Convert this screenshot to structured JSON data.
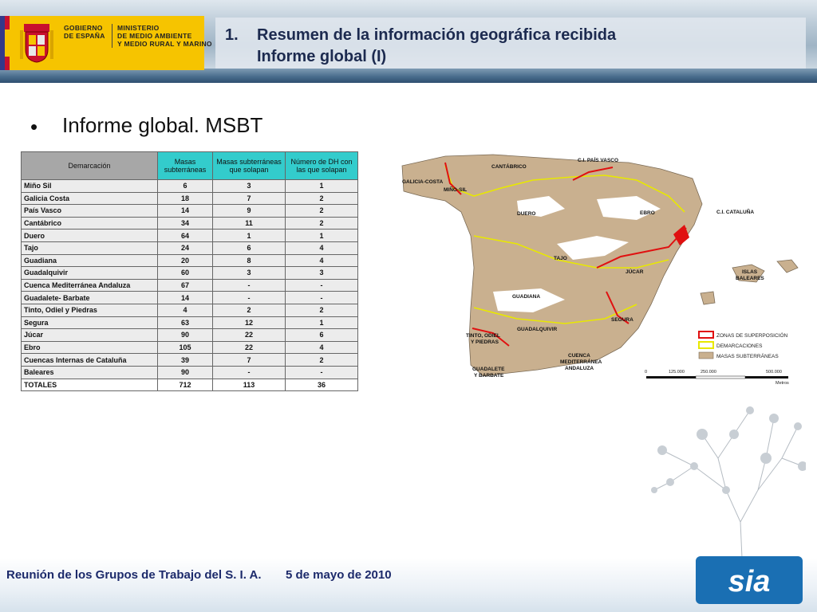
{
  "header": {
    "gobierno": [
      "GOBIERNO",
      "DE ESPAÑA"
    ],
    "ministerio": [
      "MINISTERIO",
      "DE MEDIO AMBIENTE",
      "Y MEDIO RURAL Y MARINO"
    ],
    "title_number": "1.",
    "title_line1": "Resumen de la información geográfica recibida",
    "title_line2": "Informe global (I)"
  },
  "main": {
    "bullet": "•",
    "heading": "Informe global. MSBT"
  },
  "table": {
    "headers": [
      "Demarcación",
      "Masas subterráneas",
      "Masas subterráneas que solapan",
      "Número de DH con las que solapan"
    ],
    "rows": [
      [
        "Miño Sil",
        "6",
        "3",
        "1"
      ],
      [
        "Galicia Costa",
        "18",
        "7",
        "2"
      ],
      [
        "País Vasco",
        "14",
        "9",
        "2"
      ],
      [
        "Cantábrico",
        "34",
        "11",
        "2"
      ],
      [
        "Duero",
        "64",
        "1",
        "1"
      ],
      [
        "Tajo",
        "24",
        "6",
        "4"
      ],
      [
        "Guadiana",
        "20",
        "8",
        "4"
      ],
      [
        "Guadalquivir",
        "60",
        "3",
        "3"
      ],
      [
        "Cuenca Mediterránea Andaluza",
        "67",
        "-",
        "-"
      ],
      [
        "Guadalete- Barbate",
        "14",
        "-",
        "-"
      ],
      [
        "Tinto, Odiel y Piedras",
        "4",
        "2",
        "2"
      ],
      [
        "Segura",
        "63",
        "12",
        "1"
      ],
      [
        "Júcar",
        "90",
        "22",
        "6"
      ],
      [
        "Ebro",
        "105",
        "22",
        "4"
      ],
      [
        "Cuencas Internas de Cataluña",
        "39",
        "7",
        "2"
      ],
      [
        "Baleares",
        "90",
        "-",
        "-"
      ]
    ],
    "totals": [
      "TOTALES",
      "712",
      "113",
      "36"
    ]
  },
  "map": {
    "labels": {
      "pais_vasco": "C.I. PAÍS VASCO",
      "cantabrico": "CANTÁBRICO",
      "galicia": "GALICIA-COSTA",
      "mino": "MIÑO-SIL",
      "duero": "DUERO",
      "ebro": "EBRO",
      "cataluna": "C.I. CATALUÑA",
      "tajo": "TAJO",
      "jucar": "JÚCAR",
      "baleares1": "ISLAS",
      "baleares2": "BALEARES",
      "guadiana": "GUADIANA",
      "segura": "SEGURA",
      "guadalquivir": "GUADALQUIVIR",
      "tinto1": "TINTO, ODIEL",
      "tinto2": "Y PIEDRAS",
      "cuenca1": "CUENCA",
      "cuenca2": "MEDITERRÁNEA",
      "cuenca3": "ANDALUZA",
      "guadalete1": "GUADALETE",
      "guadalete2": "Y BARBATE"
    },
    "legend": [
      "ZONAS DE SUPERPOSICIÓN",
      "DEMARCACIONES",
      "MASAS SUBTERRÁNEAS"
    ],
    "scale": [
      "0",
      "125.000",
      "250.000",
      "500.000",
      "Metros"
    ],
    "colors": {
      "overlap": "#e01010",
      "boundary": "#e8e800",
      "aquifer": "#c9b08f"
    }
  },
  "footer": {
    "meeting": "Reunión de los Grupos de Trabajo del S. I. A.",
    "date": "5 de mayo de 2010",
    "logo_text": "sia"
  }
}
